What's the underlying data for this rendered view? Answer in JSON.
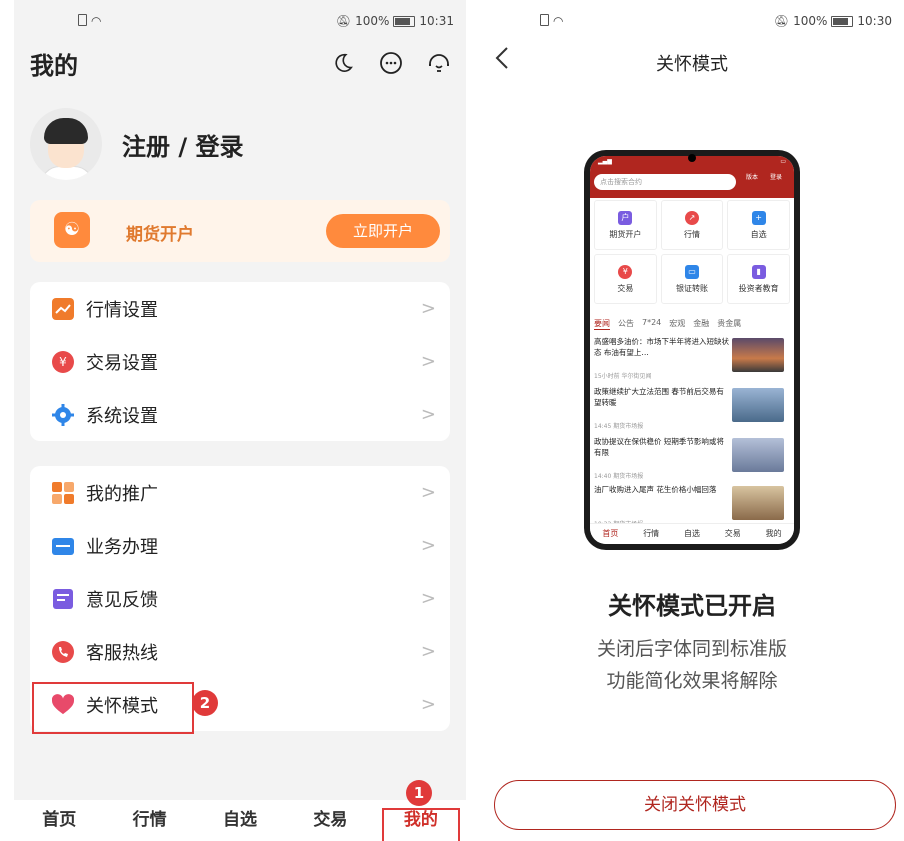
{
  "left": {
    "status": {
      "battery": "100%",
      "time": "10:31"
    },
    "title": "我的",
    "top_icons": [
      "moon-icon",
      "message-icon",
      "customer-service-icon"
    ],
    "profile": {
      "login_label": "注册 / 登录"
    },
    "futures": {
      "label": "期货开户",
      "button": "立即开户"
    },
    "settings": [
      {
        "label": "行情设置",
        "icon": "chart-icon",
        "color": "#f07b2b"
      },
      {
        "label": "交易设置",
        "icon": "yuan-icon",
        "color": "#e84a4a"
      },
      {
        "label": "系统设置",
        "icon": "gear-icon",
        "color": "#2f86e8"
      }
    ],
    "services": [
      {
        "label": "我的推广",
        "icon": "grid-icon",
        "color": "#f07b2b"
      },
      {
        "label": "业务办理",
        "icon": "briefcase-icon",
        "color": "#2f86e8"
      },
      {
        "label": "意见反馈",
        "icon": "feedback-icon",
        "color": "#7a5ce0"
      },
      {
        "label": "客服热线",
        "icon": "phone-icon",
        "color": "#e84a4a"
      },
      {
        "label": "关怀模式",
        "icon": "heart-icon",
        "color": "#e84a6a"
      }
    ],
    "badges": {
      "one": "1",
      "two": "2"
    },
    "tabs": [
      "首页",
      "行情",
      "自选",
      "交易",
      "我的"
    ],
    "active_tab": "我的"
  },
  "right": {
    "status": {
      "battery": "100%",
      "time": "10:30"
    },
    "title": "关怀模式",
    "phone_preview": {
      "search_placeholder": "点击搜索合约",
      "mini_btns": [
        "版本",
        "登录"
      ],
      "grid": [
        {
          "label": "期货开户",
          "color": "#7a5ce0",
          "glyph": "户"
        },
        {
          "label": "行情",
          "color": "#e84a4a",
          "glyph": "↗"
        },
        {
          "label": "自选",
          "color": "#2f86e8",
          "glyph": "+"
        },
        {
          "label": "交易",
          "color": "#e84a4a",
          "glyph": "¥"
        },
        {
          "label": "银证转账",
          "color": "#2f86e8",
          "glyph": "▭"
        },
        {
          "label": "投资者教育",
          "color": "#7a5ce0",
          "glyph": "▮"
        }
      ],
      "news_tabs": [
        "要闻",
        "公告",
        "7*24",
        "宏观",
        "金融",
        "贵金属"
      ],
      "news": [
        {
          "title": "高盛唱多油价：市场下半年将进入短缺状态 布油有望上…",
          "meta": "15小时前  华尔街见闻",
          "color": "#8a6a4a"
        },
        {
          "title": "政策继续扩大立法范围 春节前后交易有望转暖",
          "meta": "14:45  期货市场报",
          "color": "#5b7aa0"
        },
        {
          "title": "政协提议在保供稳价 短期季节影响或将有限",
          "meta": "14:40  期货市场报",
          "color": "#7a8aa8"
        },
        {
          "title": "油厂收购进入尾声 花生价格小幅回落",
          "meta": "10:32  期货市场报",
          "color": "#a07850"
        }
      ],
      "bottom_tabs": [
        "首页",
        "行情",
        "自选",
        "交易",
        "我的"
      ]
    },
    "heading": "关怀模式已开启",
    "line1": "关闭后字体同到标准版",
    "line2": "功能简化效果将解除",
    "close_button": "关闭关怀模式"
  }
}
